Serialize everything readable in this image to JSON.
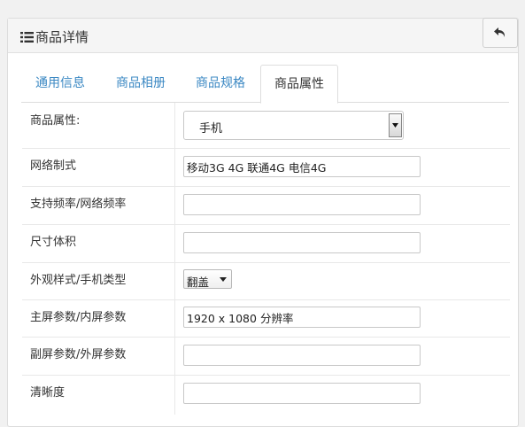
{
  "header": {
    "title": "商品详情",
    "icon": "list-icon",
    "back_icon": "undo-arrow-icon"
  },
  "tabs": [
    {
      "label": "通用信息",
      "active": false
    },
    {
      "label": "商品相册",
      "active": false
    },
    {
      "label": "商品规格",
      "active": false
    },
    {
      "label": "商品属性",
      "active": true
    }
  ],
  "form": {
    "attribute_type": {
      "label": "商品属性:",
      "value": "手机"
    },
    "network": {
      "label": "网络制式",
      "value": "移动3G 4G 联通4G 电信4G"
    },
    "frequency": {
      "label": "支持频率/网络频率",
      "value": ""
    },
    "size": {
      "label": "尺寸体积",
      "value": ""
    },
    "style": {
      "label": "外观样式/手机类型",
      "value": "翻盖"
    },
    "main_screen": {
      "label": "主屏参数/内屏参数",
      "value": "1920 x 1080 分辨率"
    },
    "sub_screen": {
      "label": "副屏参数/外屏参数",
      "value": ""
    },
    "clarity": {
      "label": "清晰度",
      "value": ""
    }
  },
  "colors": {
    "tab_link": "#3b88c3",
    "border": "#dddddd",
    "heading_bg": "#f5f5f5"
  }
}
